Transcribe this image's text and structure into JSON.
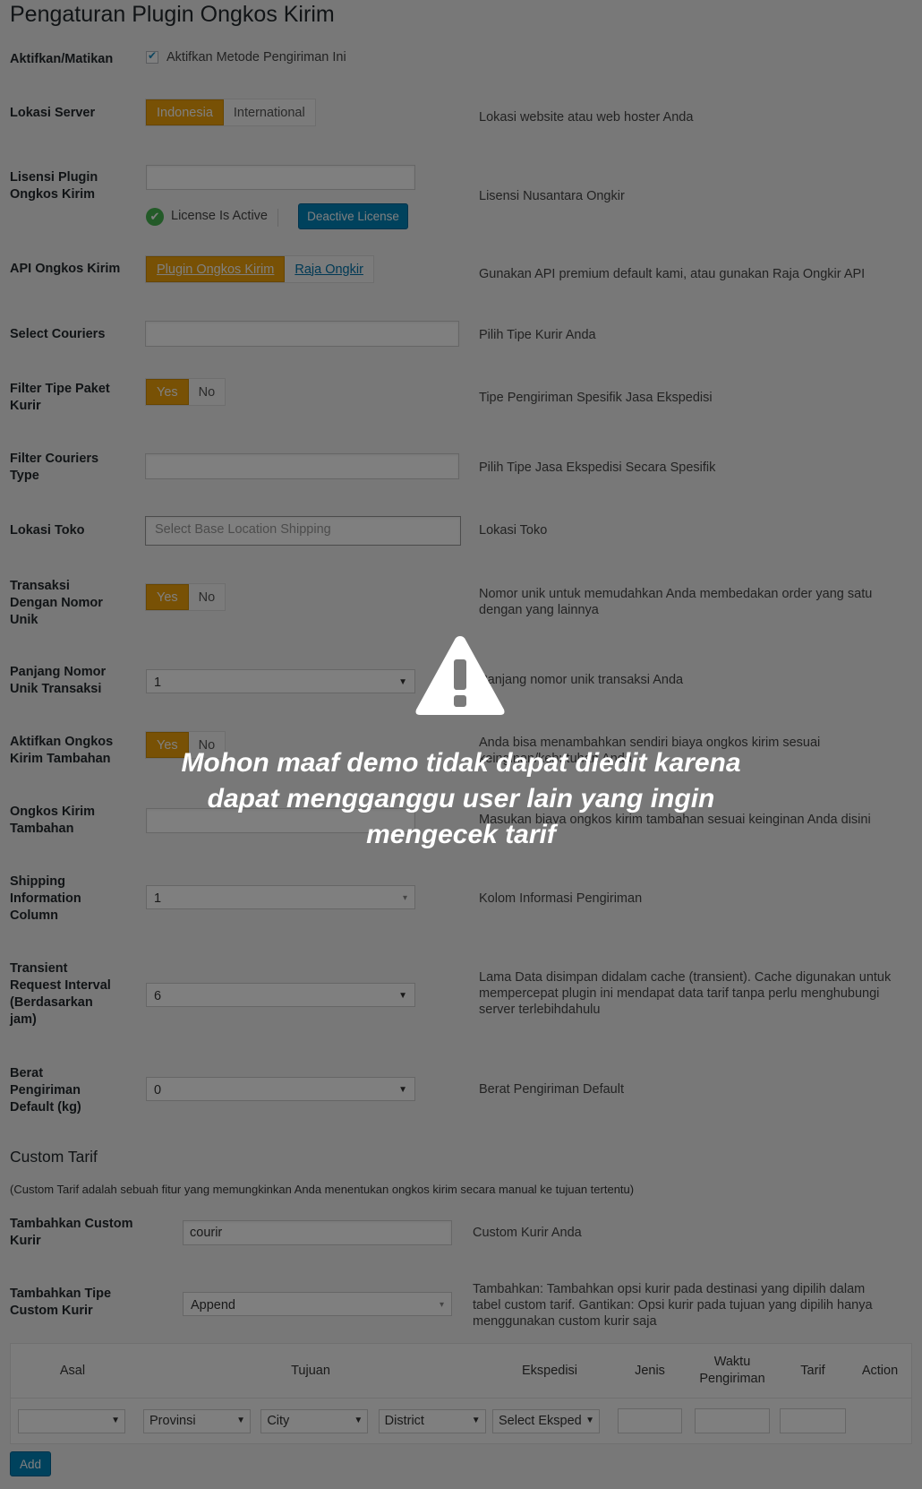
{
  "page": {
    "title": "Pengaturan Plugin Ongkos Kirim"
  },
  "fields": {
    "enable": {
      "label": "Aktifkan/Matikan",
      "checkbox_label": "Aktifkan Metode Pengiriman Ini"
    },
    "server": {
      "label": "Lokasi Server",
      "opt1": "Indonesia",
      "opt2": "International",
      "desc": "Lokasi website atau web hoster Anda"
    },
    "license": {
      "label": "Lisensi Plugin Ongkos Kirim",
      "status": "License Is Active",
      "deactivate": "Deactive License",
      "desc": "Lisensi Nusantara Ongkir"
    },
    "api": {
      "label": "API Ongkos Kirim",
      "opt1": "Plugin Ongkos Kirim",
      "opt2": "Raja Ongkir",
      "desc": "Gunakan API premium default kami, atau gunakan Raja Ongkir API"
    },
    "couriers": {
      "label": "Select Couriers",
      "desc": "Pilih Tipe Kurir Anda"
    },
    "filter_paket": {
      "label": "Filter Tipe Paket Kurir",
      "yes": "Yes",
      "no": "No",
      "desc": "Tipe Pengiriman Spesifik Jasa Ekspedisi"
    },
    "filter_type": {
      "label": "Filter Couriers Type",
      "desc": "Pilih Tipe Jasa Ekspedisi Secara Spesifik"
    },
    "toko": {
      "label": "Lokasi Toko",
      "placeholder": "Select Base Location Shipping",
      "desc": "Lokasi Toko"
    },
    "unik": {
      "label": "Transaksi Dengan Nomor Unik",
      "yes": "Yes",
      "no": "No",
      "desc": "Nomor unik untuk memudahkan Anda membedakan order yang satu dengan yang lainnya"
    },
    "panjang": {
      "label": "Panjang Nomor Unik Transaksi",
      "value": "1",
      "desc": "Panjang nomor unik transaksi Anda"
    },
    "tambahan_toggle": {
      "label": "Aktifkan Ongkos Kirim Tambahan",
      "yes": "Yes",
      "no": "No",
      "desc": "Anda bisa menambahkan sendiri biaya ongkos kirim sesuai keinginan/kebutuhan Anda"
    },
    "tambahan": {
      "label": "Ongkos Kirim Tambahan",
      "desc": "Masukan biaya ongkos kirim tambahan sesuai keinginan Anda disini"
    },
    "info_col": {
      "label": "Shipping Information Column",
      "value": "1",
      "desc": "Kolom Informasi Pengiriman"
    },
    "transient": {
      "label": "Transient Request Interval (Berdasarkan jam)",
      "value": "6",
      "desc": "Lama Data disimpan didalam cache (transient). Cache digunakan untuk mempercepat plugin ini mendapat data tarif tanpa perlu menghubungi server terlebihdahulu"
    },
    "berat": {
      "label": "Berat Pengiriman Default (kg)",
      "value": "0",
      "desc": "Berat Pengiriman Default"
    }
  },
  "custom": {
    "title": "Custom Tarif",
    "note": "(Custom Tarif adalah sebuah fitur yang memungkinkan Anda menentukan ongkos kirim secara manual ke tujuan tertentu)",
    "kurir": {
      "label": "Tambahkan Custom Kurir",
      "value": "courir",
      "desc": "Custom Kurir Anda"
    },
    "tipe": {
      "label": "Tambahkan Tipe Custom Kurir",
      "value": "Append",
      "desc": "Tambahkan: Tambahkan opsi kurir pada destinasi yang dipilih dalam tabel custom tarif. Gantikan: Opsi kurir pada tujuan yang dipilih hanya menggunakan custom kurir saja"
    }
  },
  "table": {
    "headers": {
      "asal": "Asal",
      "tujuan": "Tujuan",
      "ekspedisi": "Ekspedisi",
      "jenis": "Jenis",
      "waktu": "Waktu Pengiriman",
      "tarif": "Tarif",
      "action": "Action"
    },
    "row": {
      "provinsi": "Provinsi",
      "city": "City",
      "district": "District",
      "eksped": "Select Eksped"
    }
  },
  "add_button": "Add",
  "overlay": {
    "message": "Mohon maaf demo tidak dapat diedit karena dapat mengganggu user lain yang ingin mengecek tarif"
  },
  "colors": {
    "accent": "#f0a30a",
    "primary_button": "#0085ba",
    "active_check": "#46b450"
  }
}
